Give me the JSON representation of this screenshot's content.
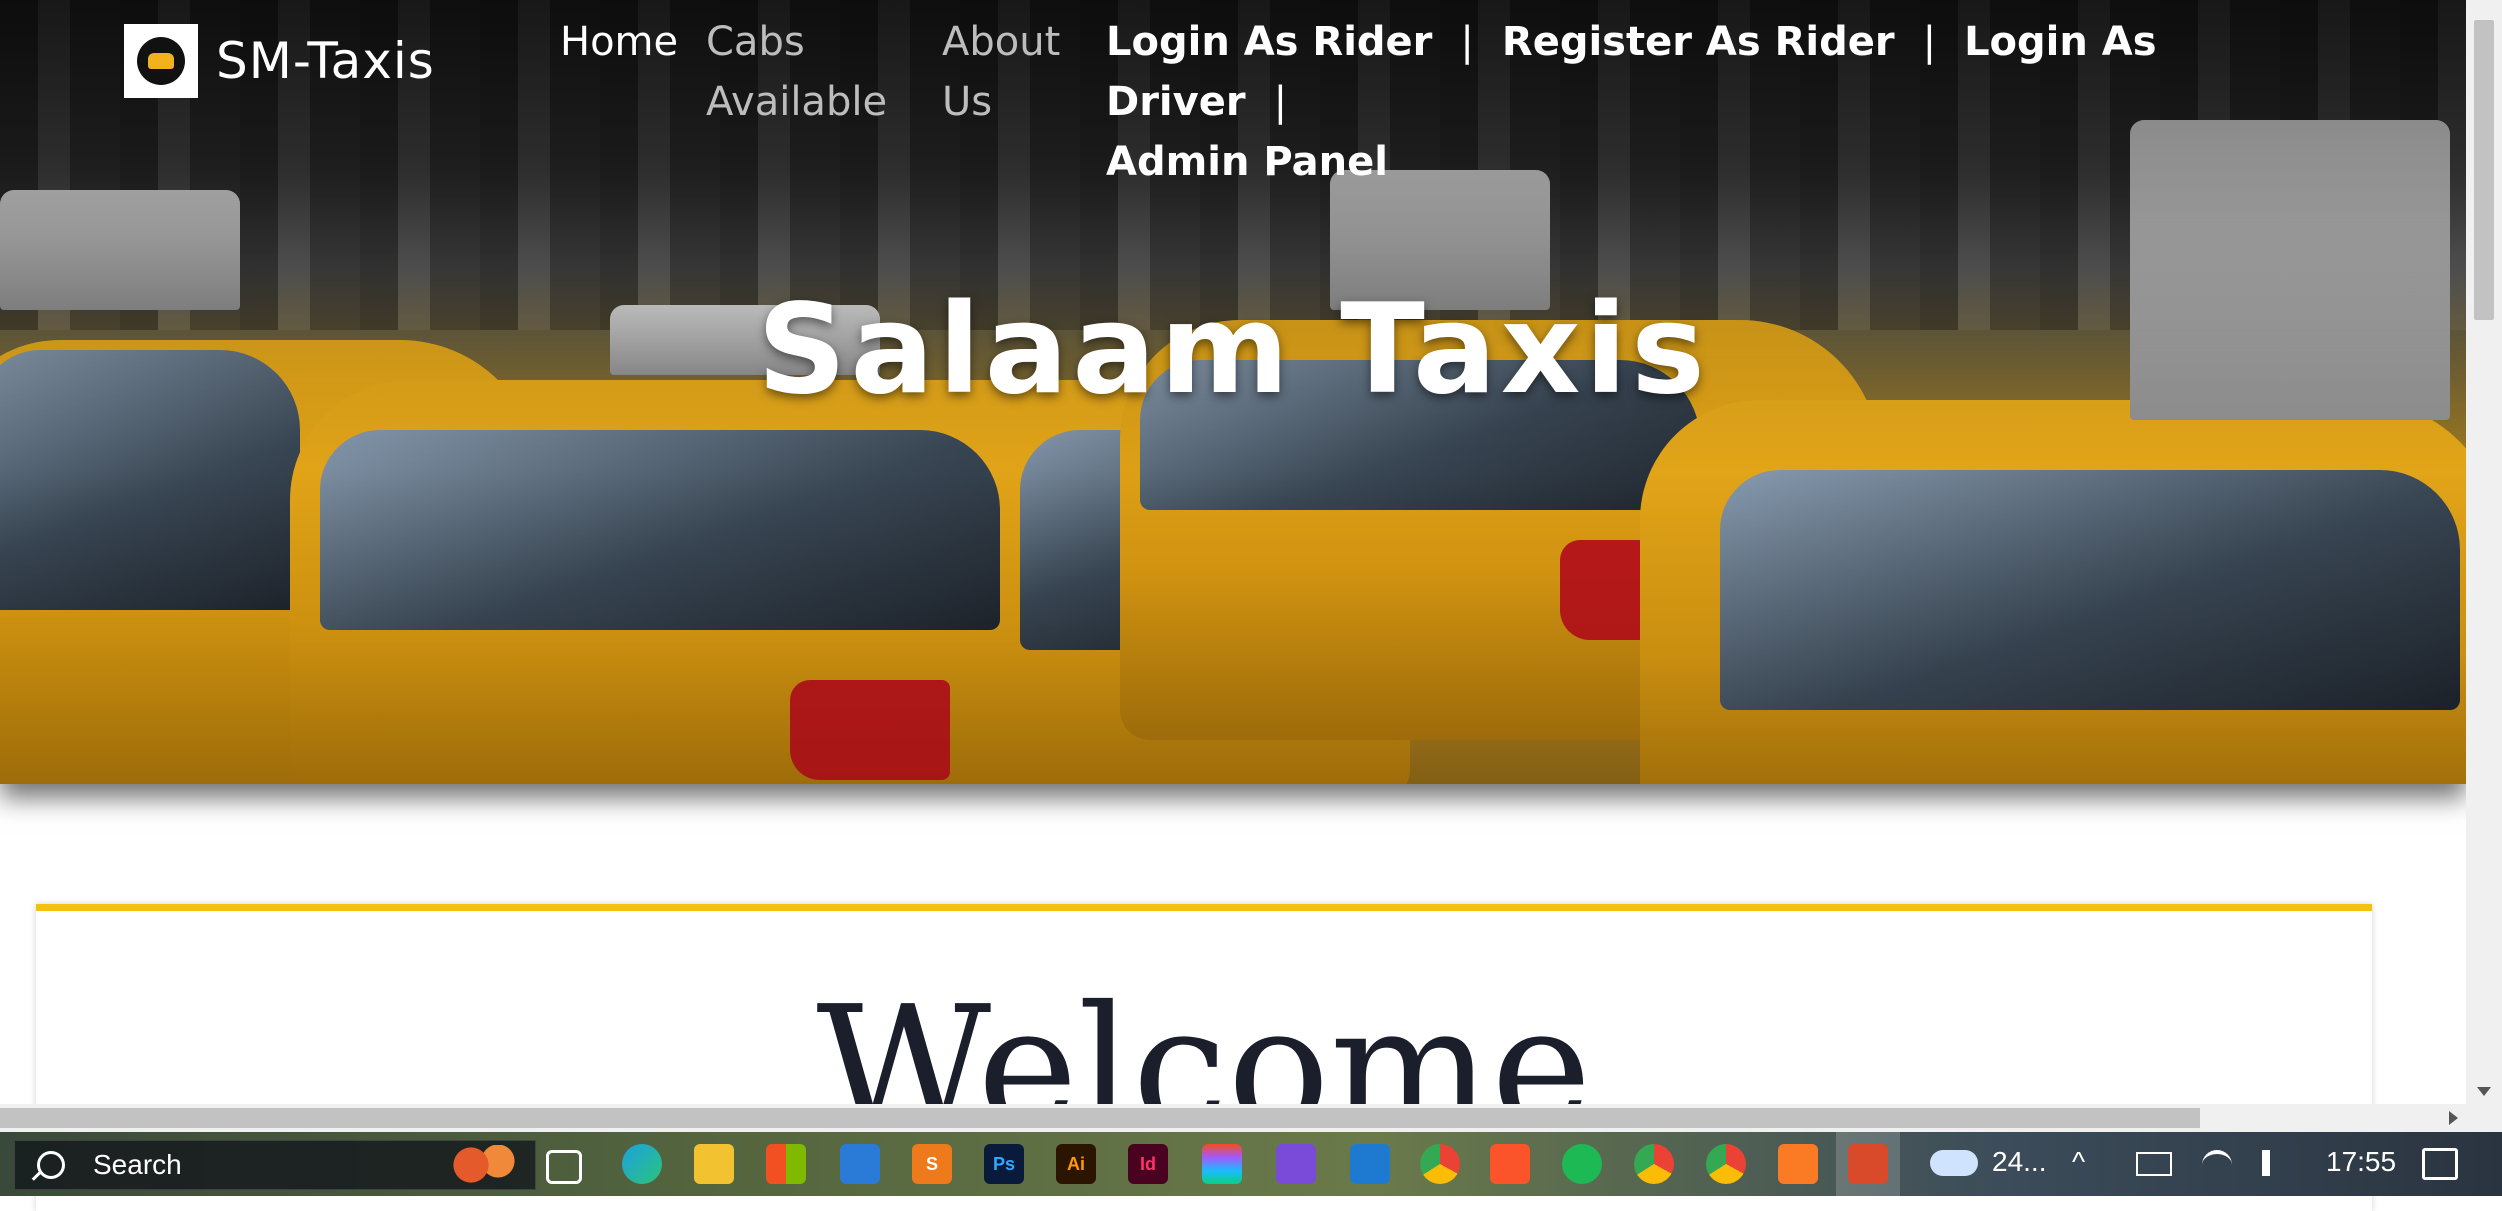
{
  "site": {
    "brand_name": "SM-Taxis",
    "hero_title": "Salaam Taxis",
    "welcome_heading": "Welcome"
  },
  "nav": {
    "home": "Home",
    "cabs_line1": "Cabs",
    "cabs_line2": "Available",
    "about_line1": "About",
    "about_line2": "Us",
    "login_rider": "Login As Rider",
    "register_rider": "Register As Rider",
    "login_driver": "Login As Driver",
    "admin_panel": "Admin Panel",
    "separator": "|"
  },
  "taskbar": {
    "search_label": "Search",
    "weather_text": "24...",
    "time": "17:55",
    "apps": [
      {
        "name": "edge",
        "glyph": "e"
      },
      {
        "name": "file-explorer",
        "glyph": ""
      },
      {
        "name": "microsoft-store",
        "glyph": ""
      },
      {
        "name": "mail",
        "glyph": ""
      },
      {
        "name": "sublime-text",
        "glyph": "S"
      },
      {
        "name": "photoshop",
        "glyph": "Ps"
      },
      {
        "name": "illustrator",
        "glyph": "Ai"
      },
      {
        "name": "indesign",
        "glyph": "Id"
      },
      {
        "name": "figma",
        "glyph": ""
      },
      {
        "name": "video-editor",
        "glyph": ""
      },
      {
        "name": "vscode",
        "glyph": ""
      },
      {
        "name": "chrome",
        "glyph": ""
      },
      {
        "name": "brave",
        "glyph": ""
      },
      {
        "name": "spotify",
        "glyph": ""
      },
      {
        "name": "chrome-profile-2",
        "glyph": ""
      },
      {
        "name": "chrome-profile-3",
        "glyph": ""
      },
      {
        "name": "xampp",
        "glyph": ""
      },
      {
        "name": "active-app",
        "glyph": ""
      }
    ]
  },
  "colors": {
    "accent_yellow": "#f5c012",
    "heading_dark": "#1a1f2b",
    "nav_muted": "#bdbdbd"
  }
}
